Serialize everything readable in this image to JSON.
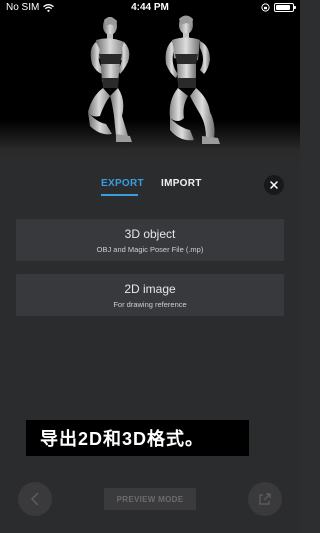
{
  "status_bar": {
    "carrier": "No SIM",
    "time": "4:44 PM"
  },
  "tabs": [
    {
      "label": "EXPORT",
      "active": true
    },
    {
      "label": "IMPORT",
      "active": false
    }
  ],
  "options": [
    {
      "title": "3D object",
      "subtitle": "OBJ and Magic Poser File (.mp)"
    },
    {
      "title": "2D image",
      "subtitle": "For drawing reference"
    }
  ],
  "bottom_bar": {
    "preview_label": "PREVIEW MODE"
  },
  "caption": "导出2D和3D格式。",
  "colors": {
    "accent": "#3b9de0",
    "panel": "#2b2c2e",
    "option_bg": "#38393c"
  },
  "icons": {
    "wifi": "wifi-icon",
    "close": "close-icon",
    "back": "chevron-left-icon",
    "share": "share-icon"
  }
}
